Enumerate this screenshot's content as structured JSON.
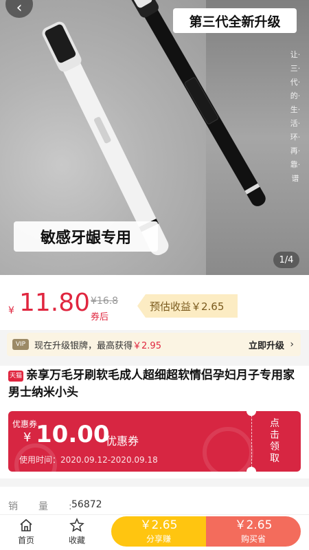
{
  "hero": {
    "badge": "第三代全新升级",
    "side_slogan": "让·三·代·的·生·活·环·再·靠·谱",
    "caption": "敏感牙龈专用",
    "pager": "1/4"
  },
  "price": {
    "currency": "¥",
    "current": "11.80",
    "original": "¥16.8",
    "after_label": "券后",
    "estimated": "预估收益￥2.65"
  },
  "upgrade": {
    "vip": "VIP",
    "text_prefix": "现在升级银牌，最高获得",
    "amount": "￥2.95",
    "link": "立即升级"
  },
  "product": {
    "tmall_tag": "天猫",
    "title": "亲享万毛牙刷软毛成人超细超软情侣孕妇月子专用家男士纳米小头"
  },
  "coupon": {
    "tag": "优惠券",
    "currency": "¥",
    "amount": "10.00",
    "unit": "优惠券",
    "period": "使用时间：2020.09.12-2020.09.18",
    "claim": "点击领取"
  },
  "sales": {
    "label": "销量:",
    "value": "56872"
  },
  "bottom_bar": {
    "home_label": "首页",
    "favorite_label": "收藏",
    "share_price": "￥2.65",
    "share_label": "分享赚",
    "buy_price": "￥2.65",
    "buy_label": "购买省"
  },
  "colors": {
    "accent_red": "#e0263f",
    "coupon_red": "#d72642",
    "share_yellow": "#ffc510",
    "buy_orange": "#f36c5c"
  }
}
